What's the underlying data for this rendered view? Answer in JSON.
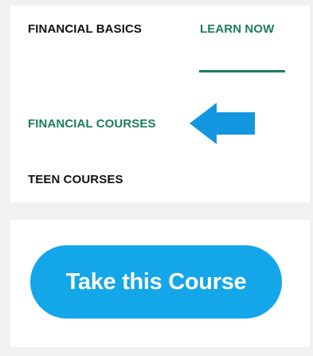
{
  "nav": {
    "items": [
      {
        "label": "FINANCIAL BASICS"
      },
      {
        "label": "LEARN NOW",
        "active": true
      },
      {
        "label": "FINANCIAL COURSES",
        "highlighted": true
      },
      {
        "label": "TEEN COURSES"
      }
    ],
    "pointer_icon": "arrow-left-icon"
  },
  "cta": {
    "label": "Take this Course"
  },
  "colors": {
    "background": "#f1f1f1",
    "accent_green": "#1a7d5a",
    "button_blue": "#13a6e8",
    "arrow_blue": "#1296e0",
    "text_dark": "#111111"
  }
}
